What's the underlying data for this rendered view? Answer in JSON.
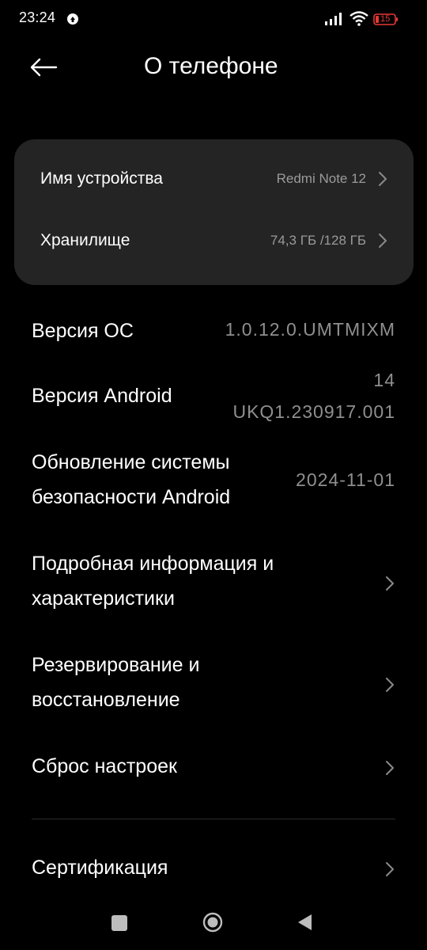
{
  "status_bar": {
    "time": "23:24",
    "battery_level": "15",
    "icons": [
      "notification-icon",
      "signal-icon",
      "wifi-icon",
      "battery-icon"
    ]
  },
  "header": {
    "title": "О телефоне",
    "back_icon": "arrow-left-icon"
  },
  "card": {
    "rows": [
      {
        "label": "Имя устройства",
        "value": "Redmi Note 12"
      },
      {
        "label": "Хранилище",
        "value": "74,3 ГБ /128 ГБ"
      }
    ]
  },
  "items": {
    "os_version": {
      "label": "Версия ОС",
      "value": "1.0.12.0.UMTMIXM"
    },
    "android_version": {
      "label": "Версия Android",
      "value_line1": "14",
      "value_line2": "UKQ1.230917.001"
    },
    "security_update": {
      "label_line1": "Обновление системы",
      "label_line2": "безопасности Android",
      "value": "2024-11-01"
    },
    "details": {
      "label_line1": "Подробная информация и",
      "label_line2": "характеристики"
    },
    "backup": {
      "label_line1": "Резервирование и",
      "label_line2": "восстановление"
    },
    "reset": {
      "label": "Сброс настроек"
    },
    "certification": {
      "label": "Сертификация"
    }
  },
  "nav_bar": {
    "icons": [
      "recents-icon",
      "home-icon",
      "back-icon"
    ]
  },
  "colors": {
    "background": "#000000",
    "card": "#242424",
    "secondary_text": "#8f8f8f",
    "battery_low": "#e53935"
  }
}
